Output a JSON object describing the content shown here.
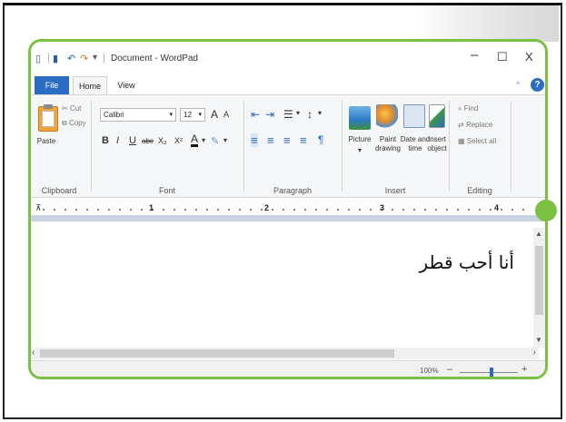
{
  "window": {
    "title": "Document - WordPad",
    "minimize_glyph": "–",
    "maximize_glyph": "☐",
    "close_glyph": "X"
  },
  "quick_access": {
    "app_glyph": "▯",
    "save_glyph": "▮",
    "undo_glyph": "↶",
    "redo_glyph": "↷",
    "more_glyph": "▾"
  },
  "tabs": [
    {
      "label": "File"
    },
    {
      "label": "Home"
    },
    {
      "label": "View"
    }
  ],
  "ribbon": {
    "help_glyph": "?",
    "minimize_glyph": "^",
    "clipboard": {
      "label": "Clipboard",
      "paste": "Paste",
      "cut": "Cut",
      "copy": "Copy"
    },
    "font": {
      "label": "Font",
      "family": "Calibri",
      "size": "12",
      "grow": "A",
      "shrink": "A",
      "bold": "B",
      "italic": "I",
      "underline": "U",
      "strike": "abc",
      "subscript": "X₂",
      "superscript": "X²",
      "color": "A",
      "highlight": "✎"
    },
    "paragraph": {
      "label": "Paragraph",
      "decrease_indent": "⇤",
      "increase_indent": "⇥",
      "list": "☰",
      "line_spacing": "↕",
      "align_left": "≡",
      "align_center": "≡",
      "align_right": "≡",
      "justify": "≡",
      "paragraph_mark": "¶"
    },
    "insert": {
      "label": "Insert",
      "picture": "Picture",
      "paint": "Paint drawing",
      "datetime": "Date and time",
      "object": "Insert object"
    },
    "editing": {
      "label": "Editing",
      "find": "Find",
      "replace": "Replace",
      "select_all": "Select all"
    }
  },
  "ruler": {
    "marks": [
      "1",
      "2",
      "3",
      "4"
    ]
  },
  "document": {
    "text": "أنا أحب قطر"
  },
  "status": {
    "zoom": "100%",
    "zoom_minus": "–",
    "zoom_plus": "+"
  },
  "colors": {
    "accent_green": "#7ac143",
    "file_tab_blue": "#2b6cc4"
  }
}
